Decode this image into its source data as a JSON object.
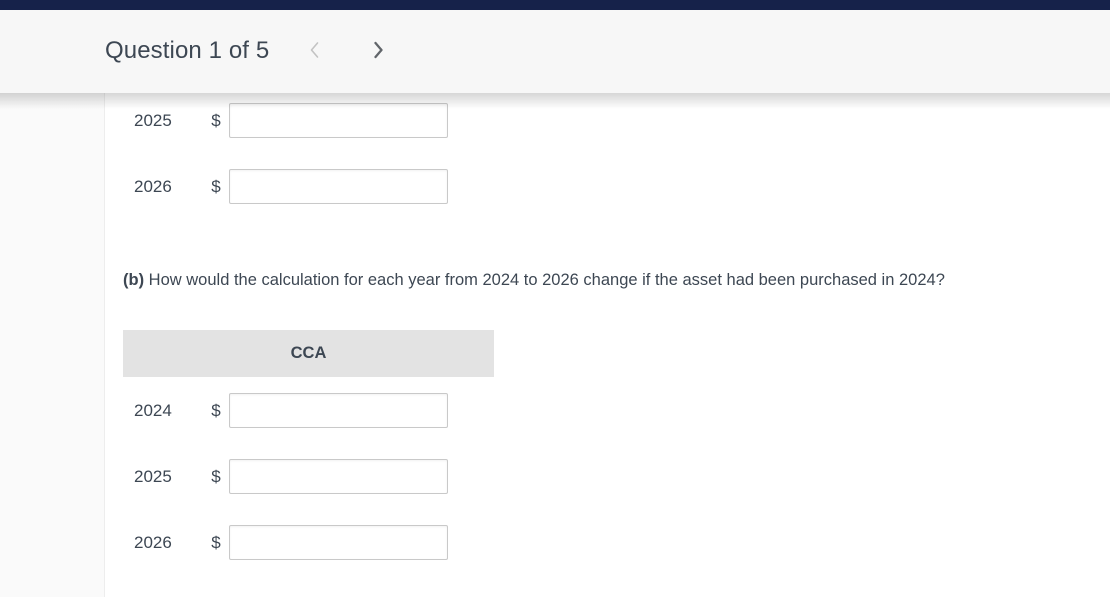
{
  "header": {
    "title": "Question 1 of 5",
    "prev_icon": "chevron-left-icon",
    "next_icon": "chevron-right-icon",
    "accent_color": "#16224a",
    "background_color": "#f7f7f7",
    "text_color": "#3d4753"
  },
  "part_a": {
    "rows": [
      {
        "year": "2025",
        "currency": "$",
        "value": "",
        "placeholder": ""
      },
      {
        "year": "2026",
        "currency": "$",
        "value": "",
        "placeholder": ""
      }
    ]
  },
  "part_b": {
    "label": "(b)",
    "question": "How would the calculation for each year from 2024 to 2026 change if the asset had been purchased in 2024?",
    "table": {
      "column_header": "CCA",
      "header_background": "#e3e3e3",
      "rows": [
        {
          "year": "2024",
          "currency": "$",
          "value": "",
          "placeholder": ""
        },
        {
          "year": "2025",
          "currency": "$",
          "value": "",
          "placeholder": ""
        },
        {
          "year": "2026",
          "currency": "$",
          "value": "",
          "placeholder": ""
        }
      ]
    }
  }
}
